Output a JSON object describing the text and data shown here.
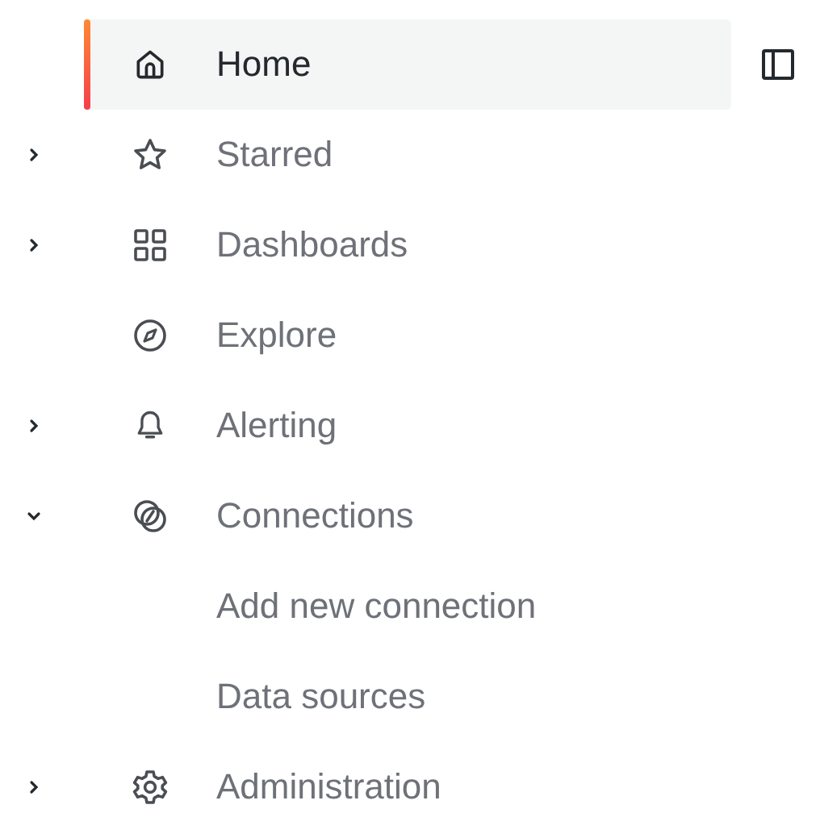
{
  "nav": {
    "items": [
      {
        "label": "Home",
        "selected": true
      },
      {
        "label": "Starred",
        "selected": false,
        "expanded": false
      },
      {
        "label": "Dashboards",
        "selected": false,
        "expanded": false
      },
      {
        "label": "Explore",
        "selected": false
      },
      {
        "label": "Alerting",
        "selected": false,
        "expanded": false
      },
      {
        "label": "Connections",
        "selected": false,
        "expanded": true,
        "children": [
          {
            "label": "Add new connection",
            "selected": false
          },
          {
            "label": "Data sources",
            "selected": false
          }
        ]
      },
      {
        "label": "Administration",
        "selected": false,
        "expanded": false
      }
    ]
  }
}
